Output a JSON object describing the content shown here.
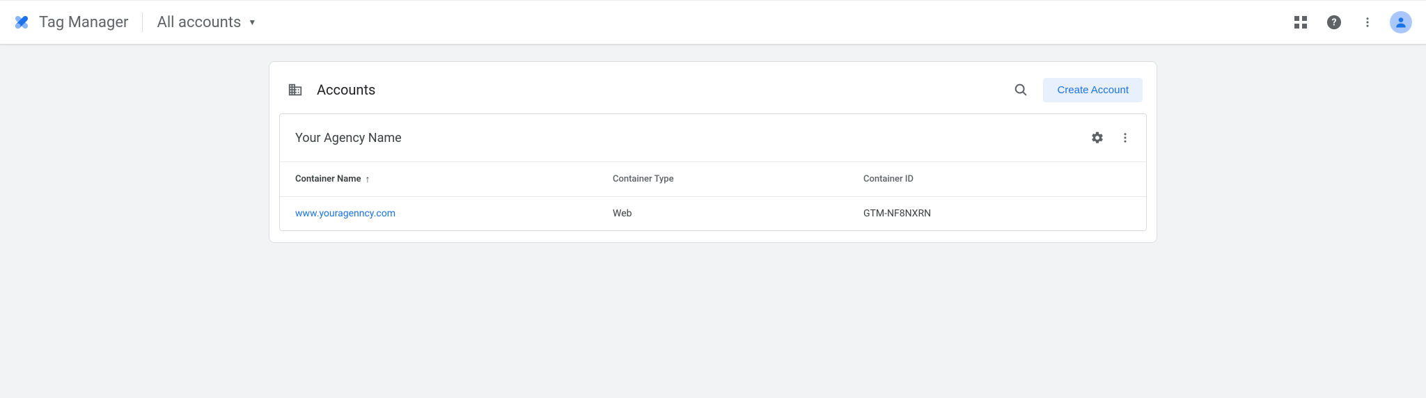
{
  "header": {
    "app_title": "Tag Manager",
    "accounts_dropdown_label": "All accounts"
  },
  "main": {
    "section_title": "Accounts",
    "create_button_label": "Create Account",
    "agency": {
      "name": "Your Agency Name",
      "columns": {
        "name": "Container Name",
        "type": "Container Type",
        "id": "Container ID"
      },
      "rows": [
        {
          "name": "www.youragenncy.com",
          "type": "Web",
          "id": "GTM-NF8NXRN"
        }
      ]
    }
  }
}
